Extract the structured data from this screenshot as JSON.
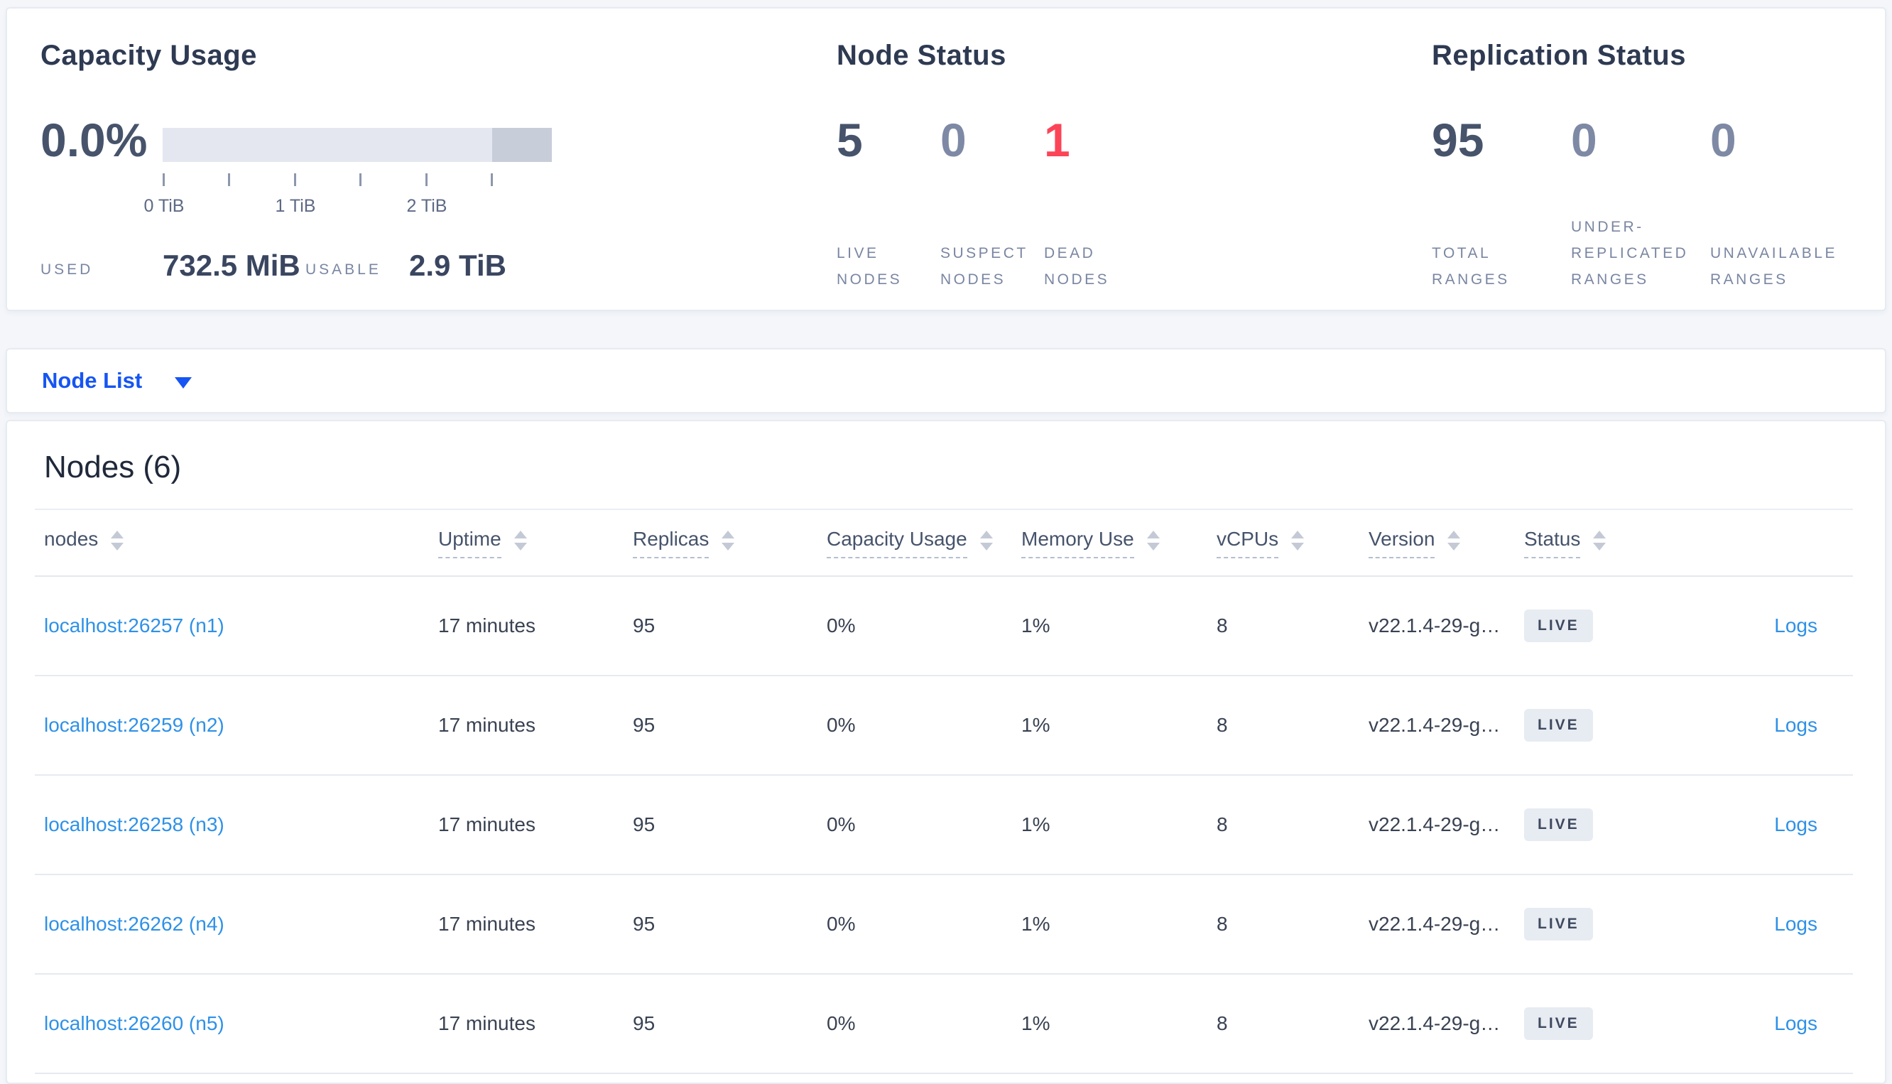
{
  "colors": {
    "link": "#2e91e7",
    "node_list_link": "#1655f2",
    "live": "#46536b",
    "suspect": "#7e89a5",
    "dead": "#fc4458"
  },
  "summary": {
    "capacity": {
      "title": "Capacity Usage",
      "percent": "0.0%",
      "ticks": [
        "0 TiB",
        "1 TiB",
        "2 TiB"
      ],
      "used_label": "USED",
      "used_value": "732.5 MiB",
      "usable_label": "USABLE",
      "usable_value": "2.9 TiB",
      "bar": {
        "track_color": "#e4e7ef",
        "segment_color": "#c7cdd9",
        "segment_pct": 15.3
      }
    },
    "node_status": {
      "title": "Node Status",
      "stats": [
        {
          "value": "5",
          "label": "LIVE NODES",
          "color": "#46536b"
        },
        {
          "value": "0",
          "label": "SUSPECT NODES",
          "color": "#7e89a5"
        },
        {
          "value": "1",
          "label": "DEAD NODES",
          "color": "#fc4458"
        }
      ]
    },
    "replication": {
      "title": "Replication Status",
      "stats": [
        {
          "value": "95",
          "label": "TOTAL RANGES",
          "color": "#46536b"
        },
        {
          "value": "0",
          "label": "UNDER-REPLICATED RANGES",
          "color": "#7e89a5"
        },
        {
          "value": "0",
          "label": "UNAVAILABLE RANGES",
          "color": "#7e89a5"
        }
      ]
    }
  },
  "node_list": {
    "label": "Node List"
  },
  "nodes_table": {
    "heading": "Nodes (6)",
    "columns": [
      {
        "label": "nodes",
        "underline": false
      },
      {
        "label": "Uptime",
        "underline": true
      },
      {
        "label": "Replicas",
        "underline": true
      },
      {
        "label": "Capacity Usage",
        "underline": true
      },
      {
        "label": "Memory Use",
        "underline": true
      },
      {
        "label": "vCPUs",
        "underline": true
      },
      {
        "label": "Version",
        "underline": true
      },
      {
        "label": "Status",
        "underline": true
      }
    ],
    "rows": [
      {
        "node": "localhost:26257 (n1)",
        "uptime": "17 minutes",
        "replicas": "95",
        "capacity": "0%",
        "memory": "1%",
        "vcpus": "8",
        "version": "v22.1.4-29-g…",
        "status": "LIVE",
        "logs": "Logs"
      },
      {
        "node": "localhost:26259 (n2)",
        "uptime": "17 minutes",
        "replicas": "95",
        "capacity": "0%",
        "memory": "1%",
        "vcpus": "8",
        "version": "v22.1.4-29-g…",
        "status": "LIVE",
        "logs": "Logs"
      },
      {
        "node": "localhost:26258 (n3)",
        "uptime": "17 minutes",
        "replicas": "95",
        "capacity": "0%",
        "memory": "1%",
        "vcpus": "8",
        "version": "v22.1.4-29-g…",
        "status": "LIVE",
        "logs": "Logs"
      },
      {
        "node": "localhost:26262 (n4)",
        "uptime": "17 minutes",
        "replicas": "95",
        "capacity": "0%",
        "memory": "1%",
        "vcpus": "8",
        "version": "v22.1.4-29-g…",
        "status": "LIVE",
        "logs": "Logs"
      },
      {
        "node": "localhost:26260 (n5)",
        "uptime": "17 minutes",
        "replicas": "95",
        "capacity": "0%",
        "memory": "1%",
        "vcpus": "8",
        "version": "v22.1.4-29-g…",
        "status": "LIVE",
        "logs": "Logs"
      }
    ]
  }
}
